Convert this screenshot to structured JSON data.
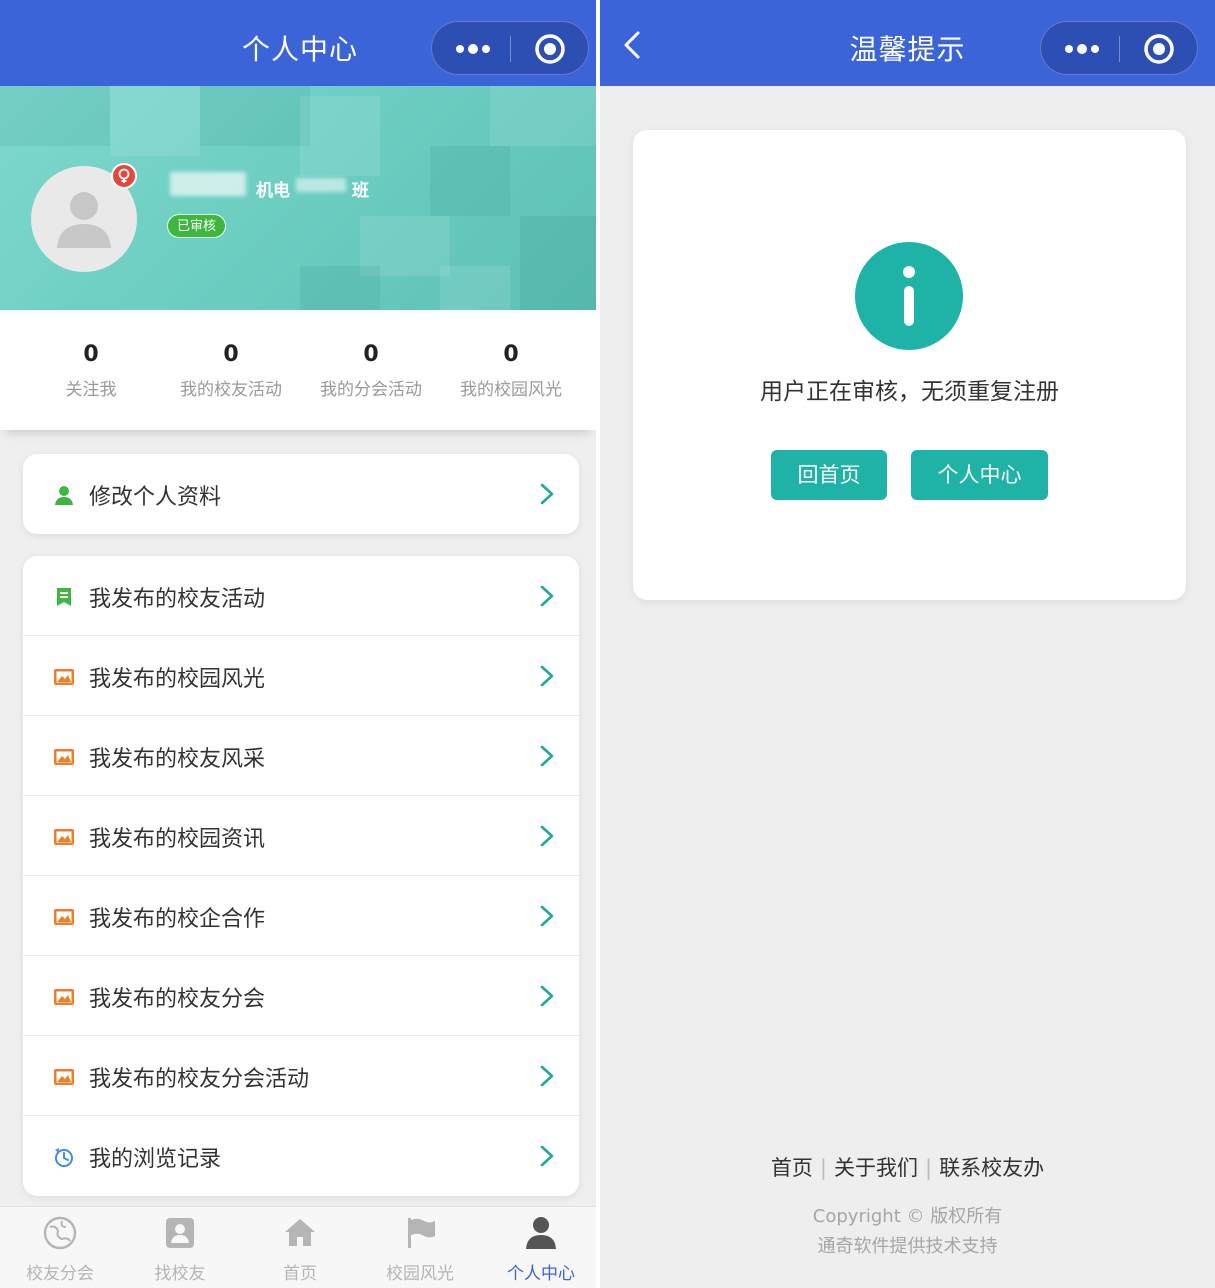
{
  "left_screen": {
    "nav_title": "个人中心",
    "profile": {
      "name_suffix_1": "机电",
      "name_suffix_2": "班",
      "status_badge": "已审核"
    },
    "stats": [
      {
        "value": "0",
        "label": "关注我"
      },
      {
        "value": "0",
        "label": "我的校友活动"
      },
      {
        "value": "0",
        "label": "我的分会活动"
      },
      {
        "value": "0",
        "label": "我的校园风光"
      }
    ],
    "edit_profile": {
      "label": "修改个人资料",
      "icon": "user-icon"
    },
    "menu": [
      {
        "label": "我发布的校友活动",
        "icon": "bookmark-icon"
      },
      {
        "label": "我发布的校园风光",
        "icon": "image-icon"
      },
      {
        "label": "我发布的校友风采",
        "icon": "image-icon"
      },
      {
        "label": "我发布的校园资讯",
        "icon": "image-icon"
      },
      {
        "label": "我发布的校企合作",
        "icon": "image-icon"
      },
      {
        "label": "我发布的校友分会",
        "icon": "image-icon"
      },
      {
        "label": "我发布的校友分会活动",
        "icon": "image-icon"
      },
      {
        "label": "我的浏览记录",
        "icon": "history-icon"
      }
    ],
    "tabbar": [
      {
        "label": "校友分会",
        "icon": "globe-icon",
        "active": false
      },
      {
        "label": "找校友",
        "icon": "contacts-icon",
        "active": false
      },
      {
        "label": "首页",
        "icon": "home-icon",
        "active": false
      },
      {
        "label": "校园风光",
        "icon": "flag-icon",
        "active": false
      },
      {
        "label": "个人中心",
        "icon": "person-icon",
        "active": true
      }
    ]
  },
  "right_screen": {
    "nav_title": "温馨提示",
    "message": "用户正在审核，无须重复注册",
    "buttons": {
      "home": "回首页",
      "center": "个人中心"
    },
    "footer": {
      "links": [
        "首页",
        "关于我们",
        "联系校友办"
      ],
      "copyright": "Copyright © 版权所有",
      "support": "通奇软件提供技术支持"
    }
  },
  "colors": {
    "nav_bg": "#3b64d9",
    "accent_teal": "#1fb2a6",
    "verified_green": "#3eb73e",
    "icon_orange": "#ef7d2a",
    "icon_green": "#3eb73e",
    "icon_blue": "#3b8fe0",
    "tab_active": "#3b64d9"
  }
}
